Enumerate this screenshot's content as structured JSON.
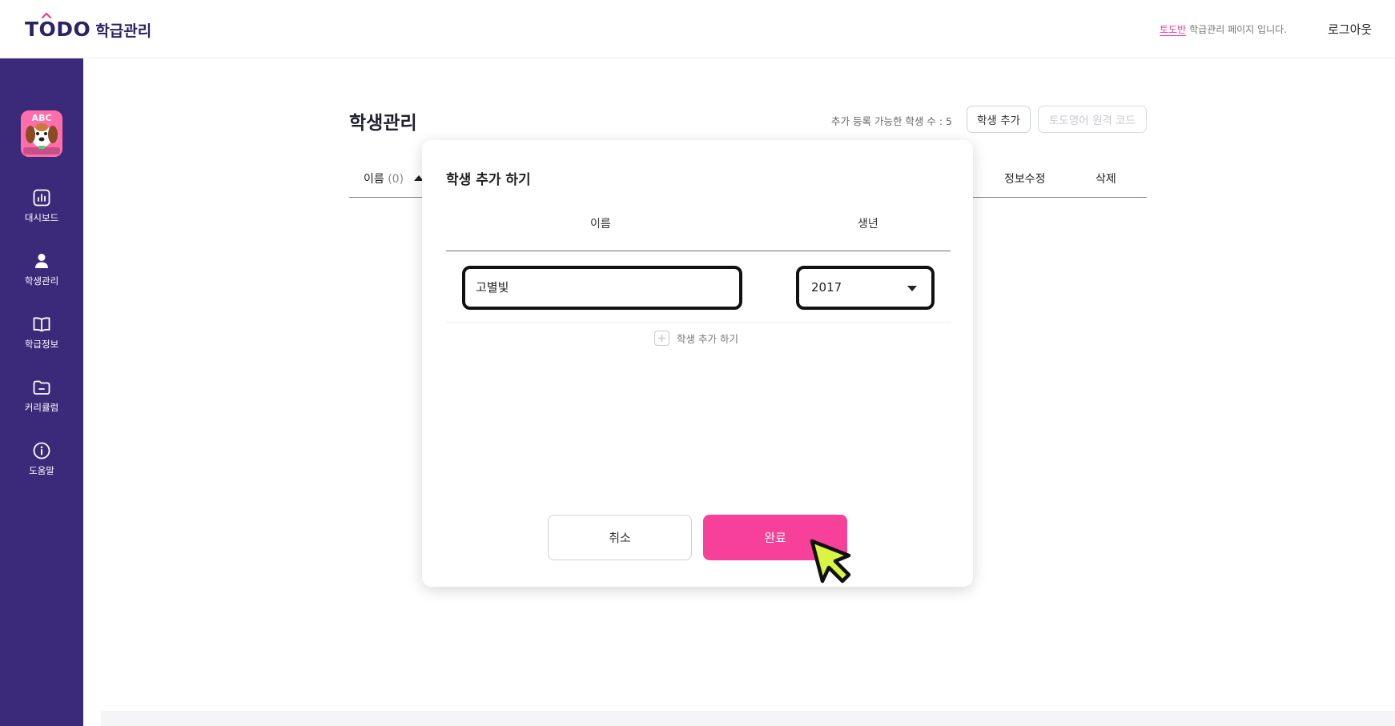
{
  "header": {
    "logo_word": "TODO",
    "logo_sub": "학급관리",
    "class_name": "토도반",
    "note": "학급관리 페이지 입니다.",
    "logout_label": "로그아웃"
  },
  "sidebar": {
    "items": [
      {
        "label": "대시보드",
        "icon": "bar-chart-icon"
      },
      {
        "label": "학생관리",
        "icon": "person-icon"
      },
      {
        "label": "학급정보",
        "icon": "book-icon"
      },
      {
        "label": "커리큘럼",
        "icon": "folder-icon"
      },
      {
        "label": "도움말",
        "icon": "info-icon"
      }
    ],
    "avatar_text": "ABC"
  },
  "main": {
    "title": "학생관리",
    "capacity_text": "추가 등록 가능한 학생 수 : 5",
    "add_student_label": "학생 추가",
    "remote_code_label": "토도영어 원격 코드",
    "columns": {
      "name": "이름",
      "name_count": "(0)",
      "edit": "정보수정",
      "delete": "삭제"
    }
  },
  "modal": {
    "title": "학생 추가 하기",
    "col_name": "이름",
    "col_birth_year": "생년",
    "name_value": "고별빛",
    "year_value": "2017",
    "add_row_label": "학생 추가 하기",
    "cancel_label": "취소",
    "done_label": "완료"
  },
  "colors": {
    "sidebar_bg": "#3b2a7a",
    "accent_pink": "#f7409a",
    "logo_navy": "#2b2363",
    "cursor_fill": "#d9f542"
  }
}
